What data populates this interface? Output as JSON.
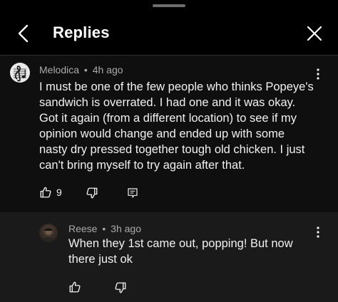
{
  "header": {
    "title": "Replies"
  },
  "comment": {
    "author": "Melodica",
    "separator": "•",
    "time": "4h ago",
    "text": "I must be one of the few people who thinks Popeye's sandwich is overrated.  I had one and it was okay.  Got it again (from a different location) to see if my opinion would change and ended up with some nasty dry pressed together tough old chicken. I just can't bring myself to try again after that.",
    "like_count": "9"
  },
  "reply": {
    "author": "Reese",
    "separator": "•",
    "time": "3h ago",
    "text": "When they 1st came out, popping! But now there just ok"
  },
  "icons": {
    "back": "chevron-left-icon",
    "close": "close-icon",
    "more": "kebab-menu-icon",
    "like": "thumbs-up-icon",
    "dislike": "thumbs-down-icon",
    "reply": "reply-comment-icon"
  }
}
